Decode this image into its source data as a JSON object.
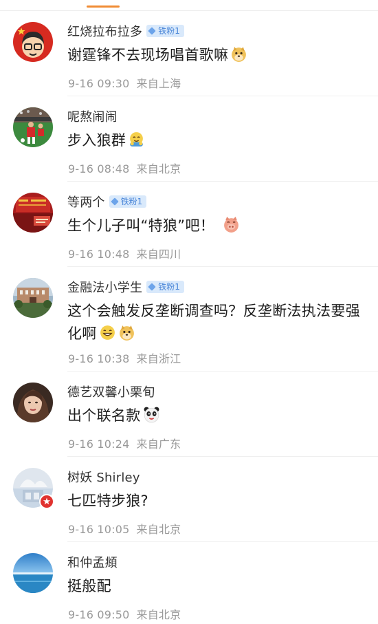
{
  "comments": [
    {
      "username": "红烧拉布拉多",
      "badge": "铁粉1",
      "text": "谢霆锋不去现场唱首歌嘛",
      "emoji": "doge-emoji",
      "time": "9-16 09:30",
      "location": "来自上海"
    },
    {
      "username": "呢熬闹闹",
      "badge": "",
      "text": "步入狼群",
      "emoji": "hug-emoji",
      "time": "9-16 08:48",
      "location": "来自北京"
    },
    {
      "username": "等两个",
      "badge": "铁粉1",
      "text": "生个儿子叫“特狼”吧！",
      "emoji": "pig-emoji",
      "time": "9-16 10:48",
      "location": "来自四川"
    },
    {
      "username": "金融法小学生",
      "badge": "铁粉1",
      "text": "这个会触发反垄断调查吗？反垄断法执法要强化啊",
      "emoji": "grin-emoji",
      "emoji2": "doge-emoji",
      "time": "9-16 10:38",
      "location": "来自浙江"
    },
    {
      "username": "德艺双馨小栗旬",
      "badge": "",
      "text": "出个联名款",
      "emoji": "panda-emoji",
      "time": "9-16 10:24",
      "location": "来自广东"
    },
    {
      "username": "树妖 Shirley",
      "badge": "",
      "text": "七匹特步狼?",
      "emoji": "",
      "time": "9-16 10:05",
      "location": "来自北京"
    },
    {
      "username": "和仲孟頫",
      "badge": "",
      "text": "挺般配",
      "emoji": "",
      "time": "9-16 09:50",
      "location": "来自北京"
    }
  ],
  "colors": {
    "accent": "#f08b33",
    "badge_bg": "#d9e9fb",
    "badge_text": "#4a86d8",
    "meta_text": "#999999"
  }
}
